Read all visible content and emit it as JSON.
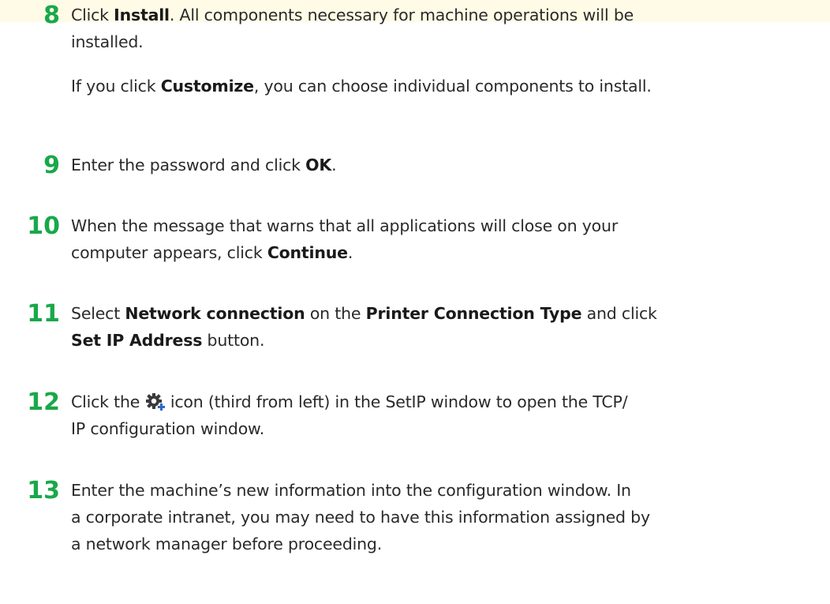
{
  "colors": {
    "step_number": "#19a84a",
    "text": "#2a2a2a"
  },
  "steps": [
    {
      "number": "8",
      "p1": [
        "Click ",
        "Install",
        ". All components necessary for machine operations will be",
        "installed."
      ],
      "p2": [
        "If you click ",
        "Customize",
        ", you can choose individual components to install."
      ]
    },
    {
      "number": "9",
      "p1": [
        "Enter the password and click ",
        "OK",
        "."
      ]
    },
    {
      "number": "10",
      "p1": [
        "When the message that warns that all applications will close on your",
        "computer appears, click ",
        "Continue",
        "."
      ]
    },
    {
      "number": "11",
      "p1": [
        "Select ",
        "Network connection",
        " on the ",
        "Printer Connection Type",
        " and click",
        "Set IP Address",
        " button."
      ]
    },
    {
      "number": "12",
      "icon": "gear-plus-icon",
      "p1": [
        "Click the ",
        " icon (third from left) in the SetIP window to open the TCP/",
        "IP configuration window."
      ]
    },
    {
      "number": "13",
      "p1": [
        "Enter the machine’s new information into the configuration window. In",
        "a corporate intranet, you may need to have this information assigned by",
        "a network manager before proceeding."
      ]
    }
  ]
}
